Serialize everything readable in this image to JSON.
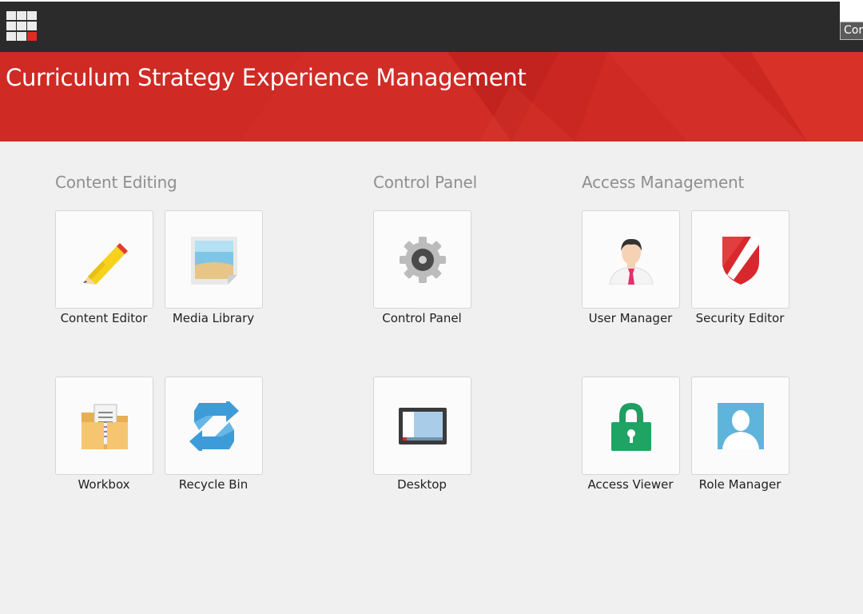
{
  "header": {
    "app_title": "Curriculum Strategy Experience Management",
    "tooltip_text": "Cor",
    "launchpad_icon": "grid-menu-icon"
  },
  "colors": {
    "topbar": "#2b2b2b",
    "banner": "#cf2a23",
    "background": "#f0f0f0",
    "group_title": "#8f8f8f"
  },
  "groups": [
    {
      "title": "Content Editing",
      "apps": [
        {
          "label": "Content Editor",
          "icon": "pencil-icon"
        },
        {
          "label": "Media Library",
          "icon": "image-icon"
        },
        {
          "label": "Workbox",
          "icon": "folder-documents-icon"
        },
        {
          "label": "Recycle Bin",
          "icon": "recycle-arrows-icon"
        }
      ]
    },
    {
      "title": "Control Panel",
      "apps": [
        {
          "label": "Control Panel",
          "icon": "gear-icon"
        },
        {
          "label": "Desktop",
          "icon": "monitor-icon"
        }
      ]
    },
    {
      "title": "Access Management",
      "apps": [
        {
          "label": "User Manager",
          "icon": "user-icon"
        },
        {
          "label": "Security Editor",
          "icon": "shield-icon"
        },
        {
          "label": "Access Viewer",
          "icon": "padlock-icon"
        },
        {
          "label": "Role Manager",
          "icon": "user-silhouette-icon"
        }
      ]
    }
  ]
}
